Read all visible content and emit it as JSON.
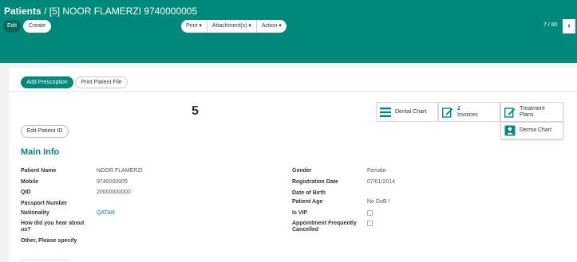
{
  "breadcrumb": {
    "root": "Patients",
    "separator": "/",
    "record": "[5] NOOR FLAMERZI 9740000005"
  },
  "toolbar": {
    "edit_label": "Edit",
    "create_label": "Create"
  },
  "actions": {
    "print_label": "Print ▾",
    "attachments_label": "Attachment(s) ▾",
    "action_label": "Action ▾"
  },
  "pager": {
    "value": "7 / 80",
    "prev_icon": "‹"
  },
  "sheet_buttons": {
    "add_prescription": "Add Prescription",
    "print_patient_file": "Print Patient File"
  },
  "record_number": "5",
  "edit_patient_id_label": "Edit Patient ID",
  "smart_buttons": {
    "dental_chart": "Dental Chart",
    "invoices_count": "2",
    "invoices_label": "Invoices",
    "treatment_plans": "Treatment Plans",
    "derma_chart": "Derma Chart"
  },
  "main_info": {
    "title": "Main Info",
    "left": [
      {
        "label": "Patient Name",
        "value": "NOOR FLAMERZI"
      },
      {
        "label": "Mobile",
        "value": "9740000005"
      },
      {
        "label": "QID",
        "value": "20000000000"
      },
      {
        "label": "Passport Number",
        "value": ""
      },
      {
        "label": "Nationality",
        "value": "QATAR"
      },
      {
        "label": "How did you hear about us?",
        "value": ""
      },
      {
        "label": "Other, Please specify",
        "value": ""
      }
    ],
    "right": [
      {
        "label": "Gender",
        "value": "Female"
      },
      {
        "label": "Registration Date",
        "value": "07/01/2014"
      },
      {
        "label": "Date of Birth",
        "value": ""
      },
      {
        "label": "Patient Age",
        "value": "No DoB !"
      },
      {
        "label": "Is VIP",
        "value": ""
      },
      {
        "label": "Appointment Frequently Cancelled",
        "value": ""
      }
    ]
  },
  "colors": {
    "brand": "#00897b",
    "brand_dark": "#00695c",
    "link": "#1f6f9b"
  }
}
